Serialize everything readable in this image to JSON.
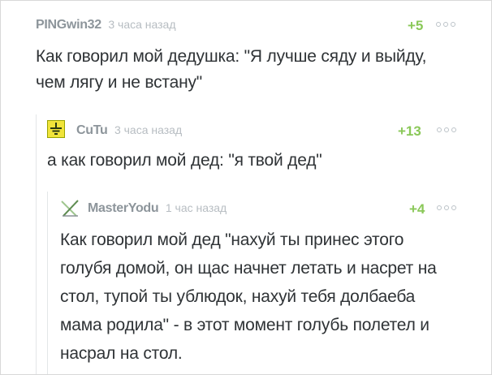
{
  "comments": [
    {
      "author": "PINGwin32",
      "time": "3 часа назад",
      "rating": "+5",
      "text_lines": [
        "Как говорил мой дедушка: \"Я лучше сяду и выйду,",
        "чем лягу и не встану\""
      ]
    },
    {
      "author": "CuTu",
      "time": "3 часа назад",
      "rating": "+13",
      "avatar_icon": "ground-symbol-icon",
      "text_lines": [
        "а как говорил мой дед: \"я твой дед\""
      ]
    },
    {
      "author": "MasterYodu",
      "time": "1 час назад",
      "rating": "+4",
      "avatar_icon": "lightsaber-cross-icon",
      "text_lines": [
        "Как говорил мой дед \"нахуй ты принес этого",
        "голубя домой, он щас начнет летать и насрет на",
        "стол, тупой ты ублюдок, нахуй тебя долбаеба",
        "мама родила\" - в этот момент голубь полетел и",
        "насрал на стол."
      ]
    }
  ],
  "colors": {
    "author": "#8d959b",
    "time": "#b7bdc2",
    "rating": "#8ac858",
    "text": "#2f3336",
    "thread_line": "#e3e6e8"
  }
}
